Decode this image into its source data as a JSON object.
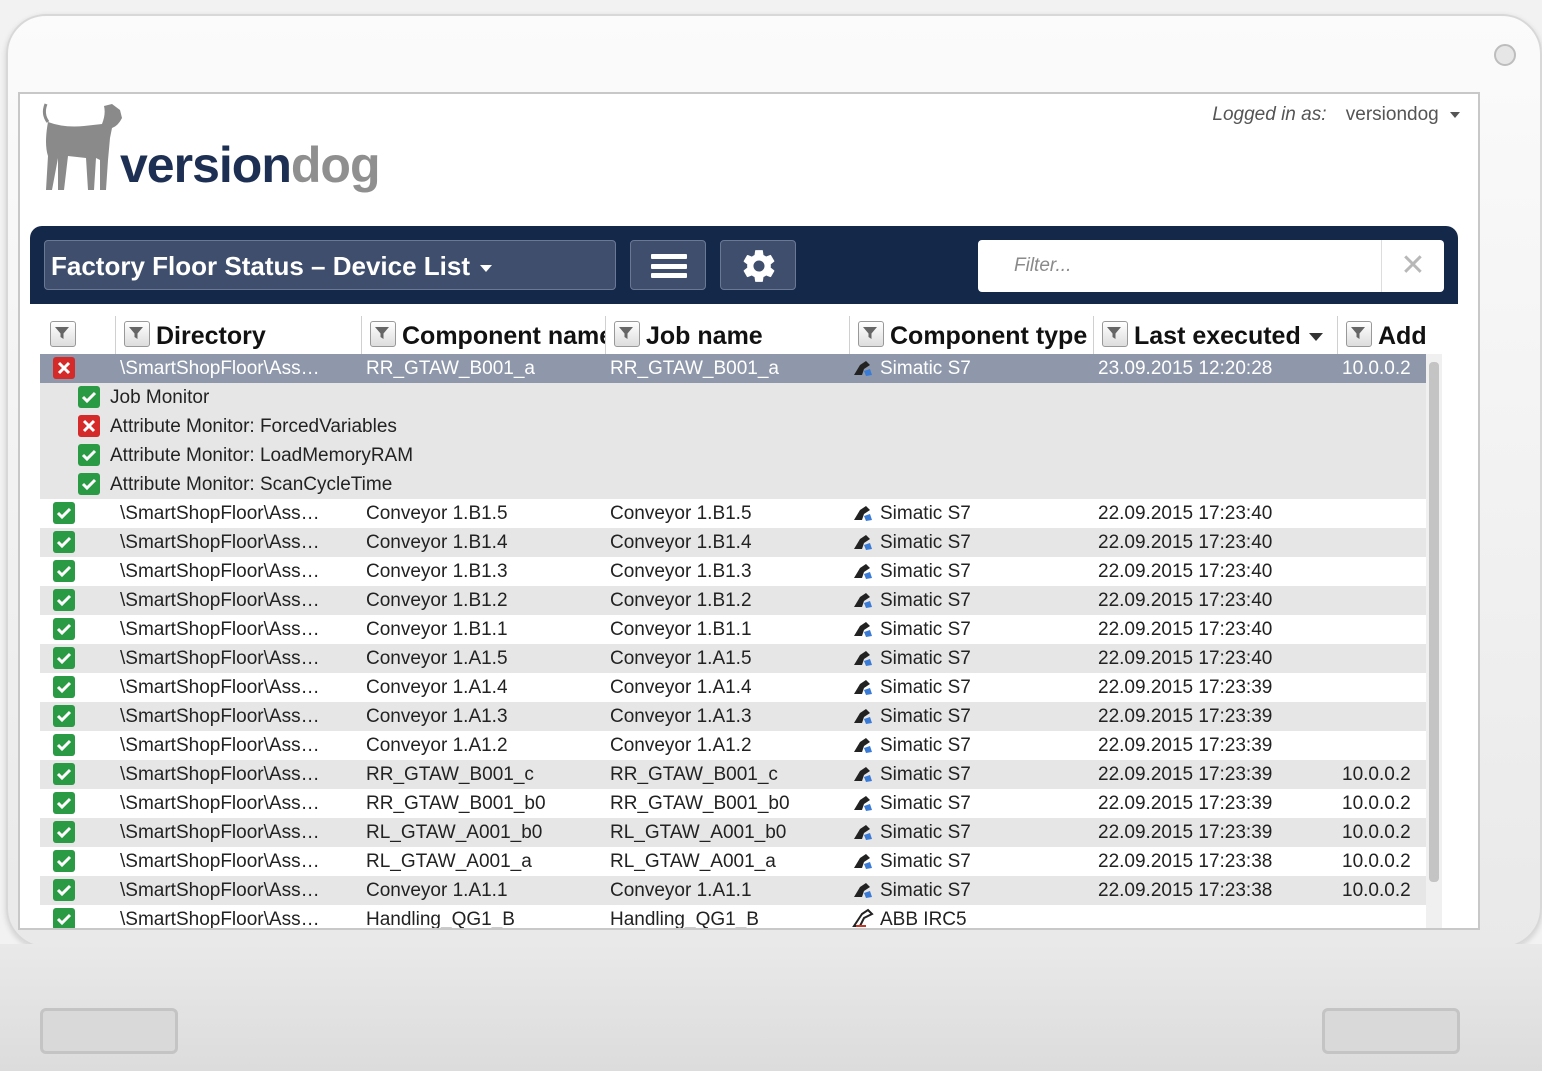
{
  "app": {
    "brand_left": "version",
    "brand_right": "dog",
    "login_label": "Logged in as:",
    "login_user": "versiondog"
  },
  "toolbar": {
    "view_title": "Factory Floor Status – Device List",
    "filter_placeholder": "Filter...",
    "clear_glyph": "✕"
  },
  "columns": [
    {
      "label": "",
      "icon": "filter-icon"
    },
    {
      "label": "Directory",
      "icon": "filter-icon"
    },
    {
      "label": "Component name",
      "icon": "filter-icon"
    },
    {
      "label": "Job name",
      "icon": "filter-icon"
    },
    {
      "label": "Component type",
      "icon": "filter-icon"
    },
    {
      "label": "Last executed",
      "icon": "filter-icon",
      "sorted": "desc"
    },
    {
      "label": "Add",
      "icon": "filter-icon"
    }
  ],
  "selected_row": {
    "status": "error",
    "directory": "\\SmartShopFloor\\Ass…",
    "component": "RR_GTAW_B001_a",
    "job": "RR_GTAW_B001_a",
    "type": "Simatic S7",
    "last": "23.09.2015 12:20:28",
    "add": "10.0.0.2"
  },
  "sub_items": [
    {
      "status": "ok",
      "label": "Job Monitor"
    },
    {
      "status": "error",
      "label": "Attribute Monitor: ForcedVariables"
    },
    {
      "status": "ok",
      "label": "Attribute Monitor: LoadMemoryRAM"
    },
    {
      "status": "ok",
      "label": "Attribute Monitor: ScanCycleTime"
    }
  ],
  "rows": [
    {
      "status": "ok",
      "directory": "\\SmartShopFloor\\Ass…",
      "component": "Conveyor 1.B1.5",
      "job": "Conveyor 1.B1.5",
      "type": "Simatic S7",
      "type_icon": "simatic-icon",
      "last": "22.09.2015 17:23:40",
      "add": ""
    },
    {
      "status": "ok",
      "directory": "\\SmartShopFloor\\Ass…",
      "component": "Conveyor 1.B1.4",
      "job": "Conveyor 1.B1.4",
      "type": "Simatic S7",
      "type_icon": "simatic-icon",
      "last": "22.09.2015 17:23:40",
      "add": ""
    },
    {
      "status": "ok",
      "directory": "\\SmartShopFloor\\Ass…",
      "component": "Conveyor 1.B1.3",
      "job": "Conveyor 1.B1.3",
      "type": "Simatic S7",
      "type_icon": "simatic-icon",
      "last": "22.09.2015 17:23:40",
      "add": ""
    },
    {
      "status": "ok",
      "directory": "\\SmartShopFloor\\Ass…",
      "component": "Conveyor 1.B1.2",
      "job": "Conveyor 1.B1.2",
      "type": "Simatic S7",
      "type_icon": "simatic-icon",
      "last": "22.09.2015 17:23:40",
      "add": ""
    },
    {
      "status": "ok",
      "directory": "\\SmartShopFloor\\Ass…",
      "component": "Conveyor 1.B1.1",
      "job": "Conveyor 1.B1.1",
      "type": "Simatic S7",
      "type_icon": "simatic-icon",
      "last": "22.09.2015 17:23:40",
      "add": ""
    },
    {
      "status": "ok",
      "directory": "\\SmartShopFloor\\Ass…",
      "component": "Conveyor 1.A1.5",
      "job": "Conveyor 1.A1.5",
      "type": "Simatic S7",
      "type_icon": "simatic-icon",
      "last": "22.09.2015 17:23:40",
      "add": ""
    },
    {
      "status": "ok",
      "directory": "\\SmartShopFloor\\Ass…",
      "component": "Conveyor 1.A1.4",
      "job": "Conveyor 1.A1.4",
      "type": "Simatic S7",
      "type_icon": "simatic-icon",
      "last": "22.09.2015 17:23:39",
      "add": ""
    },
    {
      "status": "ok",
      "directory": "\\SmartShopFloor\\Ass…",
      "component": "Conveyor 1.A1.3",
      "job": "Conveyor 1.A1.3",
      "type": "Simatic S7",
      "type_icon": "simatic-icon",
      "last": "22.09.2015 17:23:39",
      "add": ""
    },
    {
      "status": "ok",
      "directory": "\\SmartShopFloor\\Ass…",
      "component": "Conveyor 1.A1.2",
      "job": "Conveyor 1.A1.2",
      "type": "Simatic S7",
      "type_icon": "simatic-icon",
      "last": "22.09.2015 17:23:39",
      "add": ""
    },
    {
      "status": "ok",
      "directory": "\\SmartShopFloor\\Ass…",
      "component": "RR_GTAW_B001_c",
      "job": "RR_GTAW_B001_c",
      "type": "Simatic S7",
      "type_icon": "simatic-icon",
      "last": "22.09.2015 17:23:39",
      "add": "10.0.0.2"
    },
    {
      "status": "ok",
      "directory": "\\SmartShopFloor\\Ass…",
      "component": "RR_GTAW_B001_b0",
      "job": "RR_GTAW_B001_b0",
      "type": "Simatic S7",
      "type_icon": "simatic-icon",
      "last": "22.09.2015 17:23:39",
      "add": "10.0.0.2"
    },
    {
      "status": "ok",
      "directory": "\\SmartShopFloor\\Ass…",
      "component": "RL_GTAW_A001_b0",
      "job": "RL_GTAW_A001_b0",
      "type": "Simatic S7",
      "type_icon": "simatic-icon",
      "last": "22.09.2015 17:23:39",
      "add": "10.0.0.2"
    },
    {
      "status": "ok",
      "directory": "\\SmartShopFloor\\Ass…",
      "component": "RL_GTAW_A001_a",
      "job": "RL_GTAW_A001_a",
      "type": "Simatic S7",
      "type_icon": "simatic-icon",
      "last": "22.09.2015 17:23:38",
      "add": "10.0.0.2"
    },
    {
      "status": "ok",
      "directory": "\\SmartShopFloor\\Ass…",
      "component": "Conveyor 1.A1.1",
      "job": "Conveyor 1.A1.1",
      "type": "Simatic S7",
      "type_icon": "simatic-icon",
      "last": "22.09.2015 17:23:38",
      "add": "10.0.0.2"
    },
    {
      "status": "ok",
      "directory": "\\SmartShopFloor\\Ass…",
      "component": "Handling_QG1_B",
      "job": "Handling_QG1_B",
      "type": "ABB IRC5",
      "type_icon": "abb-robot-icon",
      "last": "",
      "add": ""
    }
  ],
  "colors": {
    "header_bar": "#14284a",
    "brand_dark": "#1d2f52",
    "status_ok": "#2a9a44",
    "status_error": "#d42a2a",
    "selected_row": "#8e98aa"
  }
}
